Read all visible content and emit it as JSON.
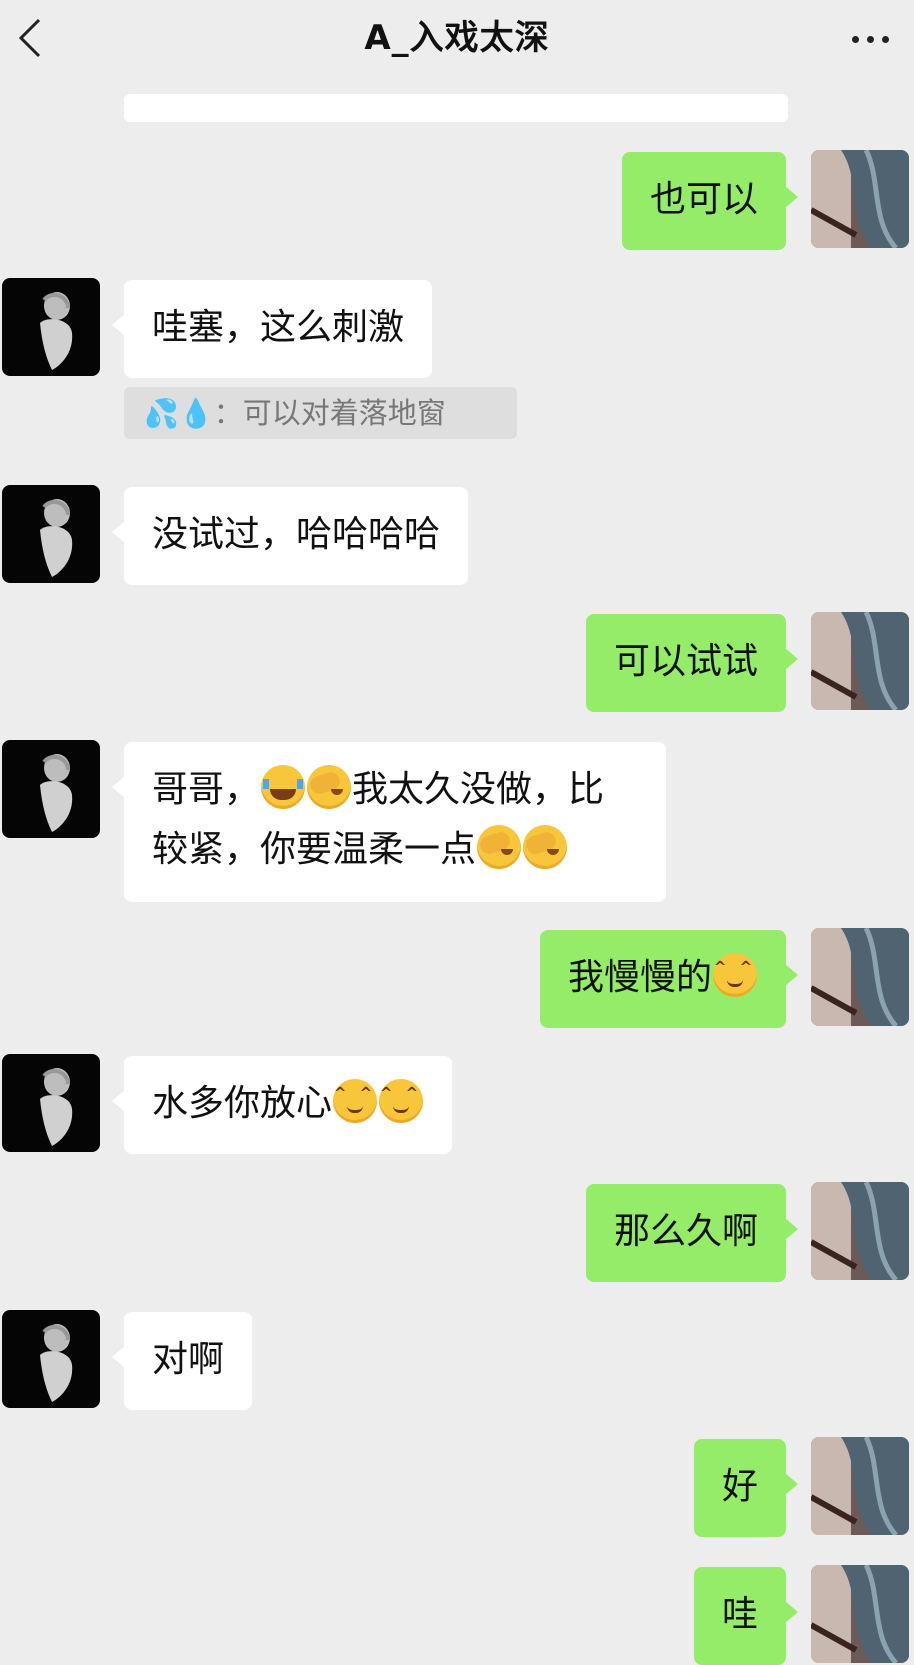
{
  "header": {
    "title": "A_入戏太深"
  },
  "quote": {
    "icons": [
      "sweat-droplets-emoji",
      "droplet-emoji"
    ],
    "text": "：可以对着落地窗"
  },
  "messages": [
    {
      "side": "out",
      "text": "也可以"
    },
    {
      "side": "in",
      "text": "哇塞，这么刺激"
    },
    {
      "side": "in",
      "text": "没试过，哈哈哈哈"
    },
    {
      "side": "out",
      "text": "可以试试"
    },
    {
      "side": "in",
      "line1": "哥哥，",
      "line1b": "我太久没做，比",
      "line2": "较紧，你要温柔一点",
      "emojis": [
        "face-with-tears-of-joy",
        "facepalm",
        "facepalm",
        "facepalm"
      ]
    },
    {
      "side": "out",
      "text": "我慢慢的",
      "emojis": [
        "blush-face"
      ]
    },
    {
      "side": "in",
      "text": "水多你放心",
      "emojis": [
        "blush-face",
        "blush-face"
      ]
    },
    {
      "side": "out",
      "text": "那么久啊"
    },
    {
      "side": "in",
      "text": "对啊"
    },
    {
      "side": "out",
      "text": "好"
    },
    {
      "side": "out",
      "text": "哇"
    }
  ],
  "colors": {
    "background": "#ededed",
    "incoming_bubble": "#ffffff",
    "outgoing_bubble": "#95ec69",
    "quote_bg": "#dedede"
  }
}
